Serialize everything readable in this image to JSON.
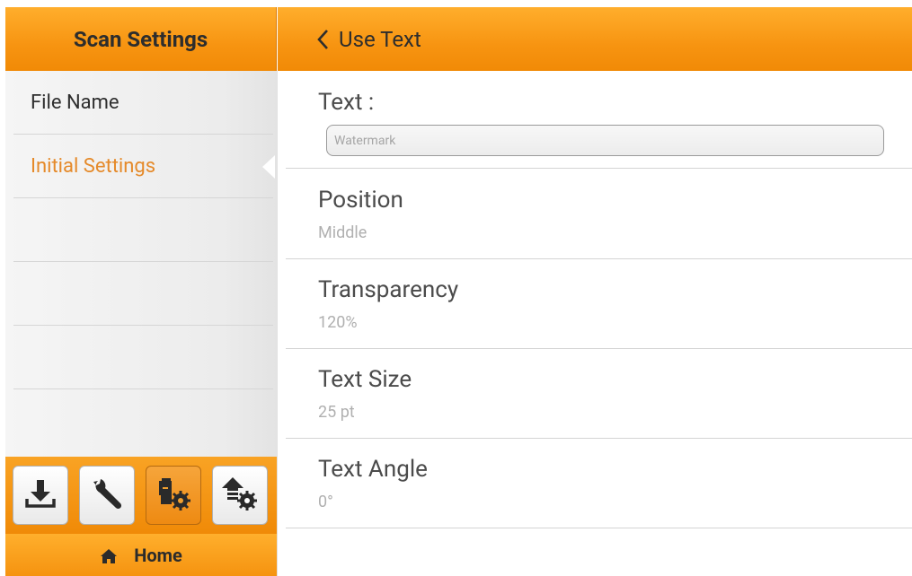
{
  "sidebar": {
    "title": "Scan Settings",
    "items": [
      {
        "label": "File Name"
      },
      {
        "label": "Initial Settings"
      },
      {
        "label": ""
      },
      {
        "label": ""
      },
      {
        "label": ""
      },
      {
        "label": ""
      }
    ]
  },
  "toolbar": {
    "buttons": [
      {
        "icon": "download-icon"
      },
      {
        "icon": "wrench-icon"
      },
      {
        "icon": "scanner-settings-icon",
        "selected": true
      },
      {
        "icon": "upload-settings-icon"
      }
    ],
    "home_label": "Home"
  },
  "header": {
    "title": "Use Text"
  },
  "form": {
    "text_label": "Text :",
    "text_placeholder": "Watermark",
    "position_label": "Position",
    "position_value": "Middle",
    "transparency_label": "Transparency",
    "transparency_value": "120%",
    "text_size_label": "Text Size",
    "text_size_value": "25 pt",
    "text_angle_label": "Text Angle",
    "text_angle_value": "0°"
  },
  "colors": {
    "accent": "#f79411",
    "active_text": "#e58a2a"
  }
}
